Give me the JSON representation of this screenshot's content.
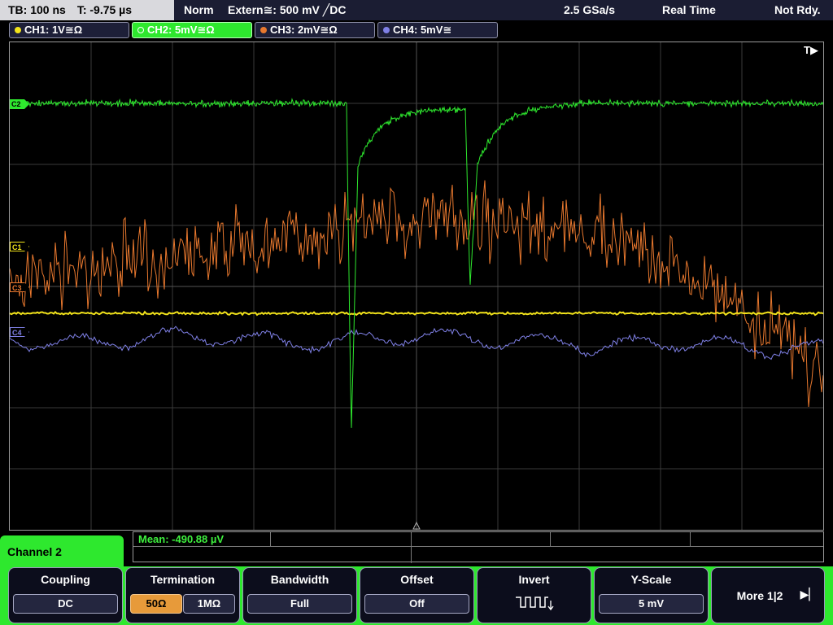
{
  "topbar": {
    "timebase": "TB: 100 ns",
    "trigger_time": "T: -9.75 µs",
    "trigger_mode": "Norm",
    "trigger_source": "Extern≅: 500 mV ╱DC",
    "sample_rate": "2.5 GSa/s",
    "acq_mode": "Real Time",
    "status": "Not Rdy."
  },
  "channels": [
    {
      "label": "CH1: 1V≅Ω",
      "color": "#f2e31b",
      "active": false
    },
    {
      "label": "CH2: 5mV≅Ω",
      "color": "#2ee82e",
      "active": true
    },
    {
      "label": "CH3: 2mV≅Ω",
      "color": "#e8782e",
      "active": false
    },
    {
      "label": "CH4: 5mV≅",
      "color": "#7f80e6",
      "active": false
    }
  ],
  "plot": {
    "trigger_indicator": "T▶",
    "markers": [
      {
        "label": "C2",
        "color": "#2ee82e"
      },
      {
        "label": "C1",
        "color": "#f2e31b"
      },
      {
        "label": "C3",
        "color": "#e8782e"
      },
      {
        "label": "C4",
        "color": "#7f80e6"
      }
    ]
  },
  "measurement": {
    "mean": "Mean: -490.88 µV"
  },
  "menu": {
    "channel_title": "Channel 2",
    "coupling": {
      "title": "Coupling",
      "value": "DC"
    },
    "termination": {
      "title": "Termination",
      "value_a": "50Ω",
      "value_b": "1MΩ"
    },
    "bandwidth": {
      "title": "Bandwidth",
      "value": "Full"
    },
    "offset": {
      "title": "Offset",
      "value": "Off"
    },
    "invert": {
      "title": "Invert",
      "icon": "square-wave-invert-icon"
    },
    "yscale": {
      "title": "Y-Scale",
      "value": "5 mV"
    },
    "more": {
      "title": "More 1|2"
    }
  }
}
